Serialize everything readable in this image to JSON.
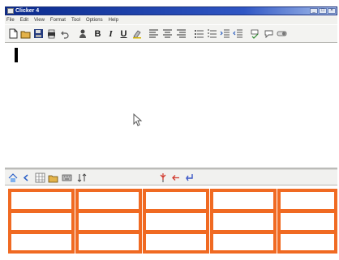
{
  "window": {
    "title": "Clicker 4",
    "controls": [
      "_",
      "□",
      "×"
    ]
  },
  "menu": [
    "File",
    "Edit",
    "View",
    "Format",
    "Tool",
    "Options",
    "Help"
  ],
  "toolbar": {
    "icons": [
      "new-document-icon",
      "open-folder-icon",
      "save-icon",
      "print-icon",
      "undo-icon",
      "speech-icon",
      "bold-icon",
      "italic-icon",
      "underline-icon",
      "highlight-icon",
      "align-left-icon",
      "align-center-icon",
      "align-right-icon",
      "bullets-icon",
      "numbering-icon",
      "indent-increase-icon",
      "indent-decrease-icon",
      "spellcheck-icon",
      "comment-icon",
      "toggle-icon"
    ],
    "bold_label": "B",
    "italic_label": "I",
    "underline_label": "U"
  },
  "editor": {
    "text": ""
  },
  "bottom_toolbar": {
    "icons": [
      "home-icon",
      "back-icon",
      "grid-icon",
      "folder-icon",
      "keyboard-icon",
      "sort-icon",
      "pin-icon",
      "arrow-left-icon",
      "enter-icon"
    ]
  },
  "grid": {
    "rows": 3,
    "columns": 5,
    "cells": [
      [
        "",
        "",
        "",
        "",
        ""
      ],
      [
        "",
        "",
        "",
        "",
        ""
      ],
      [
        "",
        "",
        "",
        "",
        ""
      ]
    ],
    "border_color": "#f06a22"
  }
}
